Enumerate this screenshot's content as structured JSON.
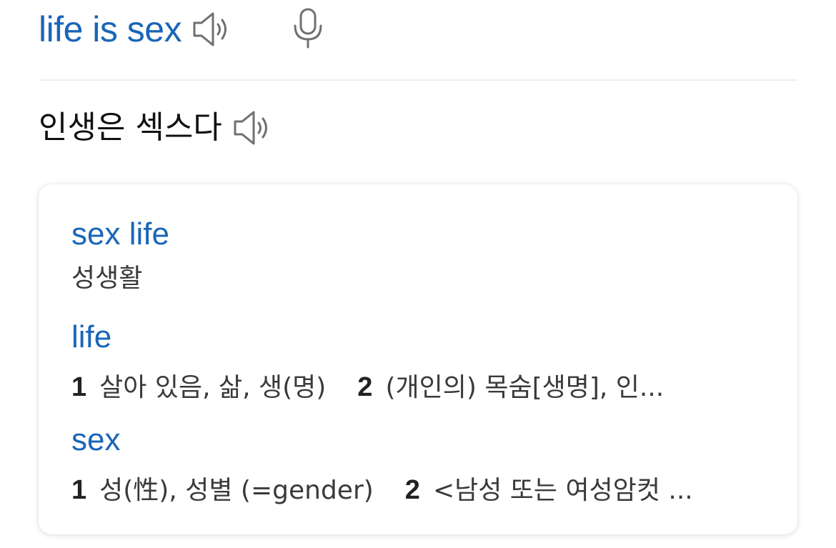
{
  "source": {
    "text": "life is sex",
    "speaker_icon": "speaker-icon",
    "mic_icon": "microphone-icon"
  },
  "translation": {
    "text": "인생은 섹스다",
    "speaker_icon": "speaker-icon"
  },
  "dictionary": {
    "entries": [
      {
        "term": "sex life",
        "definition": "성생활"
      },
      {
        "term": "life",
        "senses": [
          {
            "num": "1",
            "text": "살아 있음, 삶, 생(명)"
          },
          {
            "num": "2",
            "text": "(개인의) 목숨[생명], 인..."
          }
        ]
      },
      {
        "term": "sex",
        "senses": [
          {
            "num": "1",
            "text": "성(性), 성별 (=gender)"
          },
          {
            "num": "2",
            "text": "<남성 또는 여성암컷 ..."
          }
        ]
      }
    ]
  },
  "colors": {
    "accent": "#1a66b8",
    "icon": "#6f6f6f"
  }
}
